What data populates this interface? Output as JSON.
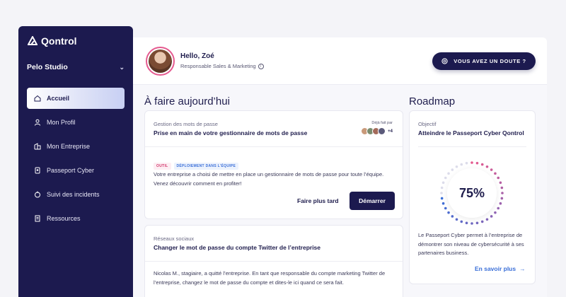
{
  "app": {
    "name": "Qontrol",
    "org": "Pelo Studio"
  },
  "sidebar": {
    "items": [
      {
        "label": "Accueil",
        "icon": "home-icon",
        "active": true
      },
      {
        "label": "Mon Profil",
        "icon": "user-icon",
        "active": false
      },
      {
        "label": "Mon Entreprise",
        "icon": "building-icon",
        "active": false
      },
      {
        "label": "Passeport Cyber",
        "icon": "passport-icon",
        "active": false
      },
      {
        "label": "Suivi des incidents",
        "icon": "alert-icon",
        "active": false
      },
      {
        "label": "Ressources",
        "icon": "book-icon",
        "active": false
      }
    ]
  },
  "header": {
    "greeting": "Hello, Zoé",
    "role": "Responsable Sales & Marketing",
    "doubt_button": "VOUS AVEZ UN DOUTE ?"
  },
  "today": {
    "title": "À faire aujourd’hui",
    "task1": {
      "category": "Gestion des mots de passe",
      "title": "Prise en main de votre gestionnaire de mots de passe",
      "done_by_label": "Déjà fait par",
      "done_by_more": "+4",
      "badges": [
        "OUTIL",
        "DÉPLOIEMENT DANS L'ÉQUIPE"
      ],
      "description": "Votre entreprise a choisi de mettre en place un gestionnaire de mots de passe pour toute l’équipe. Venez découvrir comment en profiter!",
      "later_label": "Faire plus tard",
      "start_label": "Démarrer"
    },
    "task2": {
      "category": "Réseaux sociaux",
      "title": "Changer le mot de passe du compte Twitter de l’entreprise",
      "description": "Nicolas M., stagiaire, a quitté l’entreprise. En tant que responsable du compte marketing Twitter de l’entreprise, changez le mot de passe du compte et dites-le ici quand ce sera fait."
    }
  },
  "roadmap": {
    "title": "Roadmap",
    "objective_label": "Objectif",
    "objective": "Atteindre le Passeport Cyber Qontrol",
    "progress": 0.75,
    "progress_text": "75%",
    "description": "Le Passeport Cyber permet à l’entreprise de démontrer son niveau de cybersécurité à ses partenaires business.",
    "link": "En savoir plus"
  },
  "colors": {
    "primary": "#1c1a4f",
    "accent_pink": "#e55a8f",
    "accent_blue": "#3a6fd8"
  }
}
